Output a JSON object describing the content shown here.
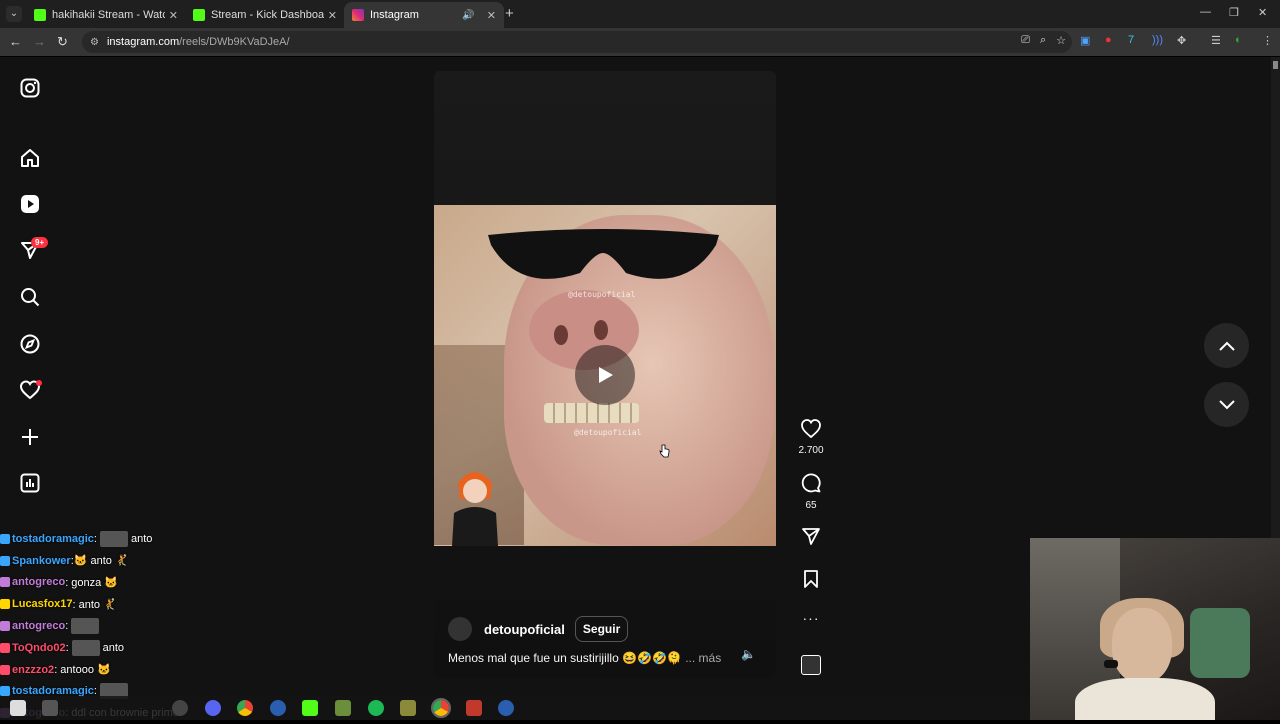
{
  "browser": {
    "tabs": [
      {
        "title": "hakihakii Stream - Watch Live o",
        "favicon_color": "#53fc18",
        "active": false
      },
      {
        "title": "Stream - Kick Dashboard",
        "favicon_color": "#53fc18",
        "active": false
      },
      {
        "title": "Instagram",
        "favicon_color": "#e1306c",
        "active": true
      }
    ],
    "url_host": "instagram.com",
    "url_path": "/reels/DWb9KVaDJeA/"
  },
  "sidebar": {
    "items": [
      {
        "name": "instagram-logo-icon"
      },
      {
        "name": "home-icon"
      },
      {
        "name": "reels-icon"
      },
      {
        "name": "messages-icon"
      },
      {
        "name": "search-icon"
      },
      {
        "name": "explore-icon"
      },
      {
        "name": "notifications-icon"
      },
      {
        "name": "create-icon"
      },
      {
        "name": "dashboard-icon"
      }
    ],
    "messages_badge": "9+"
  },
  "reel": {
    "watermark": "@detoupoficial",
    "author": "detoupoficial",
    "follow_label": "Seguir",
    "caption": "Menos mal que fue un sustirijillo 😆🤣🤣🫠",
    "caption_more": "... más",
    "likes": "2.700",
    "comments": "65"
  },
  "chat": [
    {
      "user": "tostadoramagic",
      "color": "#3aa7ff",
      "message": ": ",
      "after": " anto",
      "emote": true
    },
    {
      "user": "Spankower",
      "color": "#3aa7ff",
      "message": ": ",
      "after": "🐱 anto 🤾",
      "emote": false
    },
    {
      "user": "antogreco",
      "color": "#c27bd8",
      "message": ": gonza 🐱",
      "after": "",
      "emote": false
    },
    {
      "user": "Lucasfox17",
      "color": "#ffd700",
      "message": ": anto 🤾",
      "after": "",
      "emote": false
    },
    {
      "user": "antogreco",
      "color": "#c27bd8",
      "message": ": ",
      "after": "",
      "emote": true
    },
    {
      "user": "ToQndo02",
      "color": "#ff4c6a",
      "message": ": ",
      "after": " anto",
      "emote": true
    },
    {
      "user": "enzzzo2",
      "color": "#ff4c6a",
      "message": ": antooo 🐱",
      "after": "",
      "emote": false
    },
    {
      "user": "tostadoramagic",
      "color": "#3aa7ff",
      "message": ": ",
      "after": "",
      "emote": true
    },
    {
      "user": "antogreco",
      "color": "#c27bd8",
      "message": ": ddl con brownie prime",
      "after": "",
      "emote": false
    }
  ]
}
